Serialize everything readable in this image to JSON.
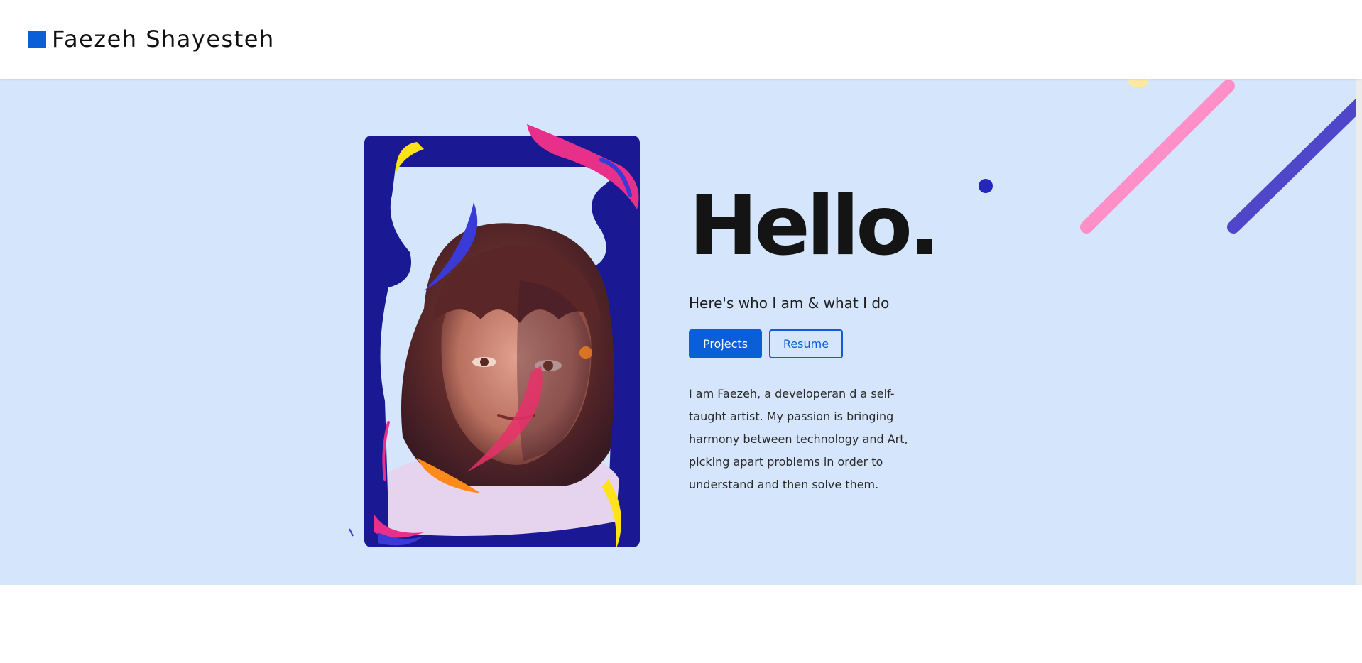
{
  "header": {
    "brand_name": "Faezeh Shayesteh",
    "brand_color": "#0a5ed7"
  },
  "hero": {
    "background": "#d5e5fb",
    "heading": "Hello.",
    "tagline": "Here's who I am & what I do",
    "buttons": {
      "primary_label": "Projects",
      "secondary_label": "Resume"
    },
    "bio": "I am Faezeh, a developeran d a self-taught artist. My passion is bringing harmony between technology and Art, picking apart problems in order to understand and then solve them.",
    "portrait": {
      "frame_color": "#1a1893",
      "description_icon": "portrait-illustration"
    },
    "decorations": {
      "pink_line_color": "#ff8fc7",
      "purple_line_color": "#4f46c9",
      "dot_color": "#2525bf",
      "yellow_color": "#ffe8a0"
    }
  }
}
